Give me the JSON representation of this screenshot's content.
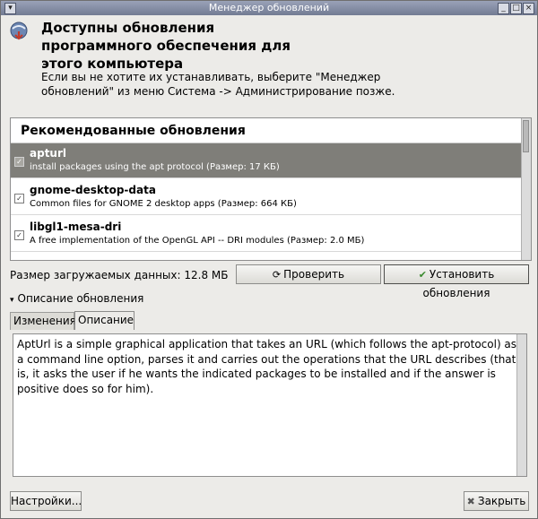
{
  "window": {
    "title": "Менеджер обновлений"
  },
  "header": {
    "title": "Доступны обновления программного обеспечения для этого компьютера",
    "description": "Если вы не хотите их устанавливать, выберите \"Менеджер обновлений\" из меню Система -> Администрирование позже."
  },
  "updates": {
    "section_title": "Рекомендованные обновления",
    "items": [
      {
        "name": "apturl",
        "description": "install packages using the apt protocol (Размер: 17 КБ)",
        "checked": true,
        "selected": true
      },
      {
        "name": "gnome-desktop-data",
        "description": "Common files for GNOME 2 desktop apps (Размер: 664 КБ)",
        "checked": true,
        "selected": false
      },
      {
        "name": "libgl1-mesa-dri",
        "description": "A free implementation of the OpenGL API -- DRI modules (Размер: 2.0 МБ)",
        "checked": true,
        "selected": false
      }
    ]
  },
  "download": {
    "label": "Размер загружаемых данных: 12.8 МБ"
  },
  "buttons": {
    "check": "Проверить",
    "install": "Установить обновления",
    "settings": "Настройки...",
    "close": "Закрыть"
  },
  "details": {
    "expander_label": "Описание обновления",
    "tabs": [
      "Изменения",
      "Описание"
    ],
    "active_tab": "Описание",
    "text": "AptUrl is a simple graphical application that takes an URL (which follows the apt-protocol) as a command line option, parses it and carries out the operations that the URL describes (that is, it asks the user if he wants the indicated packages to be installed and if the answer is positive does so for him)."
  },
  "icons": {
    "window_menu": "window-menu-icon",
    "header": "update-manager-icon",
    "check": "refresh-icon",
    "install": "checkmark-icon",
    "close": "close-icon"
  },
  "colors": {
    "titlebar": "#727b93",
    "selection": "#7f7e79",
    "window_bg": "#ecebe8"
  }
}
